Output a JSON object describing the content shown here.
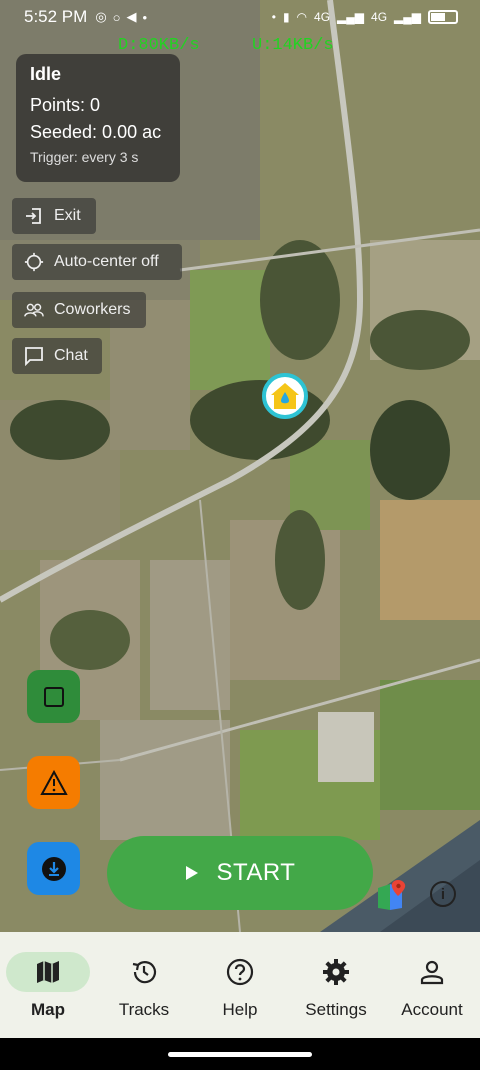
{
  "status_bar": {
    "time": "5:52 PM",
    "network_labels": [
      "4G",
      "4G"
    ]
  },
  "speed": {
    "download": "D:80KB/s",
    "upload": "U:14KB/s"
  },
  "info_panel": {
    "state": "Idle",
    "points": "Points: 0",
    "seeded": "Seeded: 0.00 ac",
    "trigger": "Trigger: every 3 s"
  },
  "controls": {
    "exit": "Exit",
    "auto_center": "Auto-center off",
    "coworkers": "Coworkers",
    "chat": "Chat"
  },
  "start_button": {
    "label": "START"
  },
  "nav": [
    {
      "label": "Map",
      "icon": "map-icon",
      "active": true
    },
    {
      "label": "Tracks",
      "icon": "history-icon",
      "active": false
    },
    {
      "label": "Help",
      "icon": "help-icon",
      "active": false
    },
    {
      "label": "Settings",
      "icon": "gear-icon",
      "active": false
    },
    {
      "label": "Account",
      "icon": "person-icon",
      "active": false
    }
  ],
  "colors": {
    "start_green": "#43a848",
    "stop_green": "#2f8c3a",
    "warning_orange": "#f57c00",
    "download_blue": "#1e88e5",
    "speed_text": "#22d322",
    "nav_bg": "#f0f2ea",
    "nav_active": "#cfe8cc"
  }
}
